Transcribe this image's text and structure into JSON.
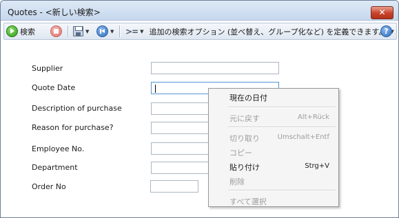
{
  "window": {
    "title": "Quotes - <新しい検索>",
    "close_label": "✕"
  },
  "toolbar": {
    "search_label": "検索",
    "options_text": "追加の検索オプション (並べ替え、グループ化など) を定義できます。",
    "help_label": "?"
  },
  "form": {
    "fields": [
      {
        "label": "Supplier",
        "value": ""
      },
      {
        "label": "Quote Date",
        "value": ""
      },
      {
        "label": "Description of purchase",
        "value": ""
      },
      {
        "label": "Reason for purchase?",
        "value": ""
      },
      {
        "label": "Employee No.",
        "value": ""
      },
      {
        "label": "Department",
        "value": ""
      },
      {
        "label": "Order No",
        "value": ""
      }
    ]
  },
  "context_menu": {
    "items": [
      {
        "label": "現在の日付",
        "shortcut": "",
        "enabled": true
      },
      {
        "label": "元に戻す",
        "shortcut": "Alt+Rück",
        "enabled": false
      },
      {
        "label": "切り取り",
        "shortcut": "Umschalt+Entf",
        "enabled": false
      },
      {
        "label": "コピー",
        "shortcut": "",
        "enabled": false
      },
      {
        "label": "貼り付け",
        "shortcut": "Strg+V",
        "enabled": true
      },
      {
        "label": "削除",
        "shortcut": "",
        "enabled": false
      },
      {
        "label": "すべて選択",
        "shortcut": "",
        "enabled": false
      }
    ]
  }
}
